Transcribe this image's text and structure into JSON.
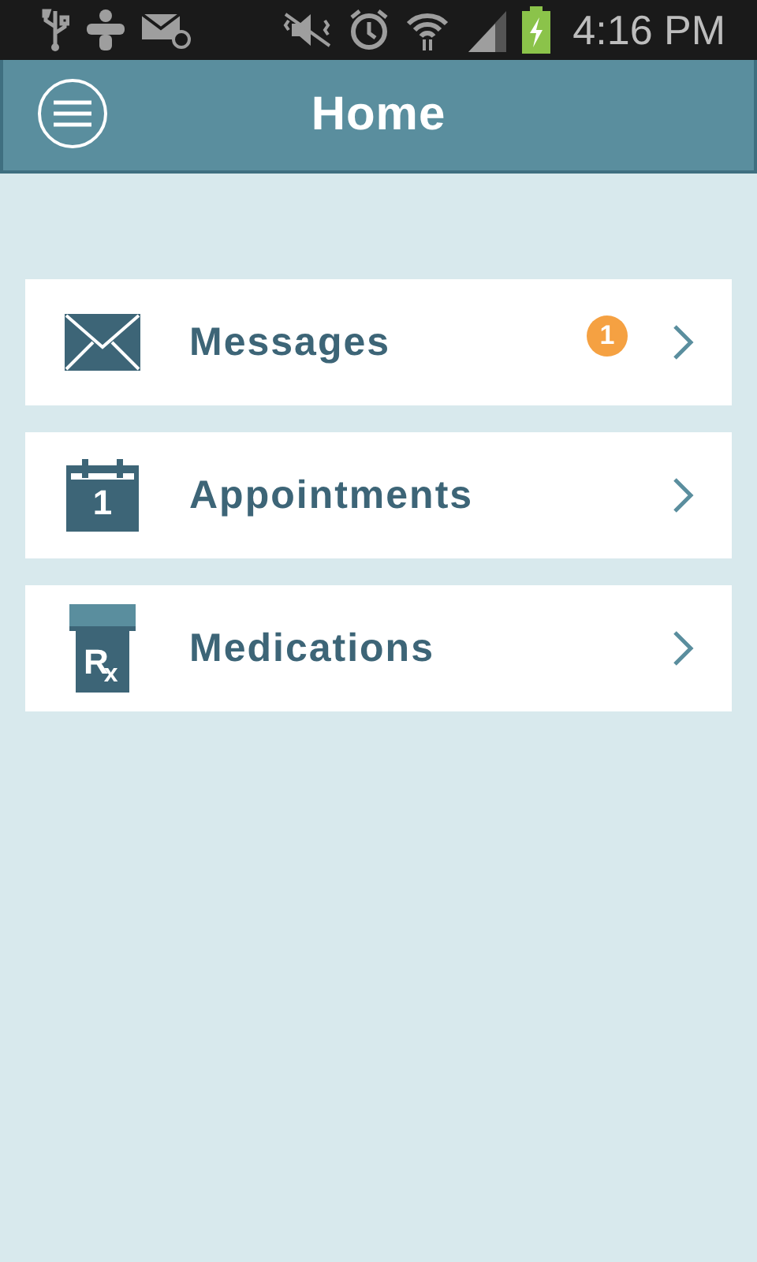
{
  "status_bar": {
    "time": "4:16 PM"
  },
  "header": {
    "title": "Home"
  },
  "menu": [
    {
      "kind": "mail",
      "label": "Messages",
      "badge": "1"
    },
    {
      "kind": "calendar",
      "label": "Appointments",
      "icon_text": "1"
    },
    {
      "kind": "rx",
      "label": "Medications",
      "icon_text": "R$_{x}$"
    }
  ]
}
